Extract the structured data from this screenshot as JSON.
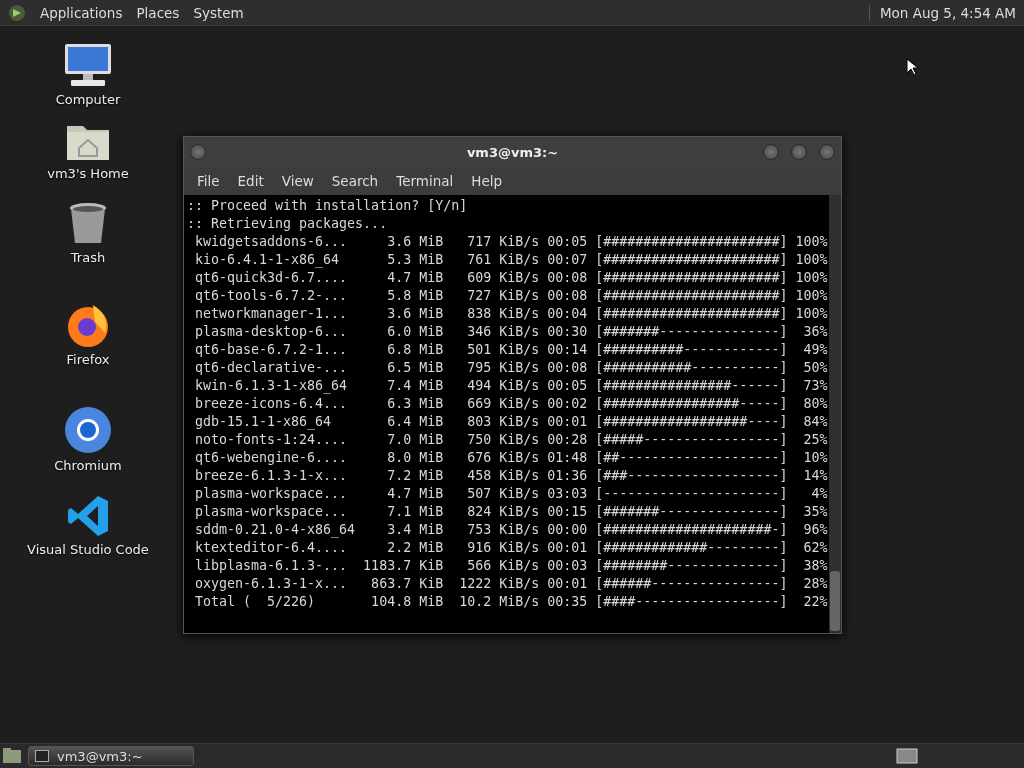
{
  "top_panel": {
    "menus": [
      "Applications",
      "Places",
      "System"
    ],
    "clock": "Mon Aug 5, 4:54 AM"
  },
  "desktop_icons": [
    {
      "kind": "computer",
      "label": "Computer"
    },
    {
      "kind": "home",
      "label": "vm3's Home"
    },
    {
      "kind": "trash",
      "label": "Trash"
    },
    {
      "kind": "firefox",
      "label": "Firefox"
    },
    {
      "kind": "chromium",
      "label": "Chromium"
    },
    {
      "kind": "vscode",
      "label": "Visual Studio Code"
    }
  ],
  "terminal_window": {
    "title": "vm3@vm3:~",
    "menu": [
      "File",
      "Edit",
      "View",
      "Search",
      "Terminal",
      "Help"
    ],
    "prompt_lines": [
      ":: Proceed with installation? [Y/n]",
      ":: Retrieving packages..."
    ],
    "downloads": [
      {
        "name": "kwidgetsaddons-6...",
        "size": "3.6 MiB",
        "speed": "717 KiB/s",
        "time": "00:05",
        "bar": "[######################]",
        "percent": "100%"
      },
      {
        "name": "kio-6.4.1-1-x86_64",
        "size": "5.3 MiB",
        "speed": "761 KiB/s",
        "time": "00:07",
        "bar": "[######################]",
        "percent": "100%"
      },
      {
        "name": "qt6-quick3d-6.7....",
        "size": "4.7 MiB",
        "speed": "609 KiB/s",
        "time": "00:08",
        "bar": "[######################]",
        "percent": "100%"
      },
      {
        "name": "qt6-tools-6.7.2-...",
        "size": "5.8 MiB",
        "speed": "727 KiB/s",
        "time": "00:08",
        "bar": "[######################]",
        "percent": "100%"
      },
      {
        "name": "networkmanager-1...",
        "size": "3.6 MiB",
        "speed": "838 KiB/s",
        "time": "00:04",
        "bar": "[######################]",
        "percent": "100%"
      },
      {
        "name": "plasma-desktop-6...",
        "size": "6.0 MiB",
        "speed": "346 KiB/s",
        "time": "00:30",
        "bar": "[#######---------------]",
        "percent": "36%"
      },
      {
        "name": "qt6-base-6.7.2-1...",
        "size": "6.8 MiB",
        "speed": "501 KiB/s",
        "time": "00:14",
        "bar": "[##########------------]",
        "percent": "49%"
      },
      {
        "name": "qt6-declarative-...",
        "size": "6.5 MiB",
        "speed": "795 KiB/s",
        "time": "00:08",
        "bar": "[###########-----------]",
        "percent": "50%"
      },
      {
        "name": "kwin-6.1.3-1-x86_64",
        "size": "7.4 MiB",
        "speed": "494 KiB/s",
        "time": "00:05",
        "bar": "[################------]",
        "percent": "73%"
      },
      {
        "name": "breeze-icons-6.4...",
        "size": "6.3 MiB",
        "speed": "669 KiB/s",
        "time": "00:02",
        "bar": "[#################-----]",
        "percent": "80%"
      },
      {
        "name": "gdb-15.1-1-x86_64",
        "size": "6.4 MiB",
        "speed": "803 KiB/s",
        "time": "00:01",
        "bar": "[##################----]",
        "percent": "84%"
      },
      {
        "name": "noto-fonts-1:24....",
        "size": "7.0 MiB",
        "speed": "750 KiB/s",
        "time": "00:28",
        "bar": "[#####-----------------]",
        "percent": "25%"
      },
      {
        "name": "qt6-webengine-6....",
        "size": "8.0 MiB",
        "speed": "676 KiB/s",
        "time": "01:48",
        "bar": "[##--------------------]",
        "percent": "10%"
      },
      {
        "name": "breeze-6.1.3-1-x...",
        "size": "7.2 MiB",
        "speed": "458 KiB/s",
        "time": "01:36",
        "bar": "[###-------------------]",
        "percent": "14%"
      },
      {
        "name": "plasma-workspace...",
        "size": "4.7 MiB",
        "speed": "507 KiB/s",
        "time": "03:03",
        "bar": "[----------------------]",
        "percent": "4%"
      },
      {
        "name": "plasma-workspace...",
        "size": "7.1 MiB",
        "speed": "824 KiB/s",
        "time": "00:15",
        "bar": "[#######---------------]",
        "percent": "35%"
      },
      {
        "name": "sddm-0.21.0-4-x86_64",
        "size": "3.4 MiB",
        "speed": "753 KiB/s",
        "time": "00:00",
        "bar": "[#####################-]",
        "percent": "96%"
      },
      {
        "name": "ktexteditor-6.4....",
        "size": "2.2 MiB",
        "speed": "916 KiB/s",
        "time": "00:01",
        "bar": "[#############---------]",
        "percent": "62%"
      },
      {
        "name": "libplasma-6.1.3-...",
        "size": "1183.7 KiB",
        "speed": "566 KiB/s",
        "time": "00:03",
        "bar": "[########--------------]",
        "percent": "38%"
      },
      {
        "name": "oxygen-6.1.3-1-x...",
        "size": "863.7 KiB",
        "speed": "1222 KiB/s",
        "time": "00:01",
        "bar": "[######----------------]",
        "percent": "28%"
      },
      {
        "name": "Total (  5/226)",
        "size": "104.8 MiB",
        "speed": "10.2 MiB/s",
        "time": "00:35",
        "bar": "[####------------------]",
        "percent": "22%"
      }
    ]
  },
  "taskbar": {
    "tasks": [
      {
        "label": "vm3@vm3:~",
        "selected": true
      }
    ]
  }
}
